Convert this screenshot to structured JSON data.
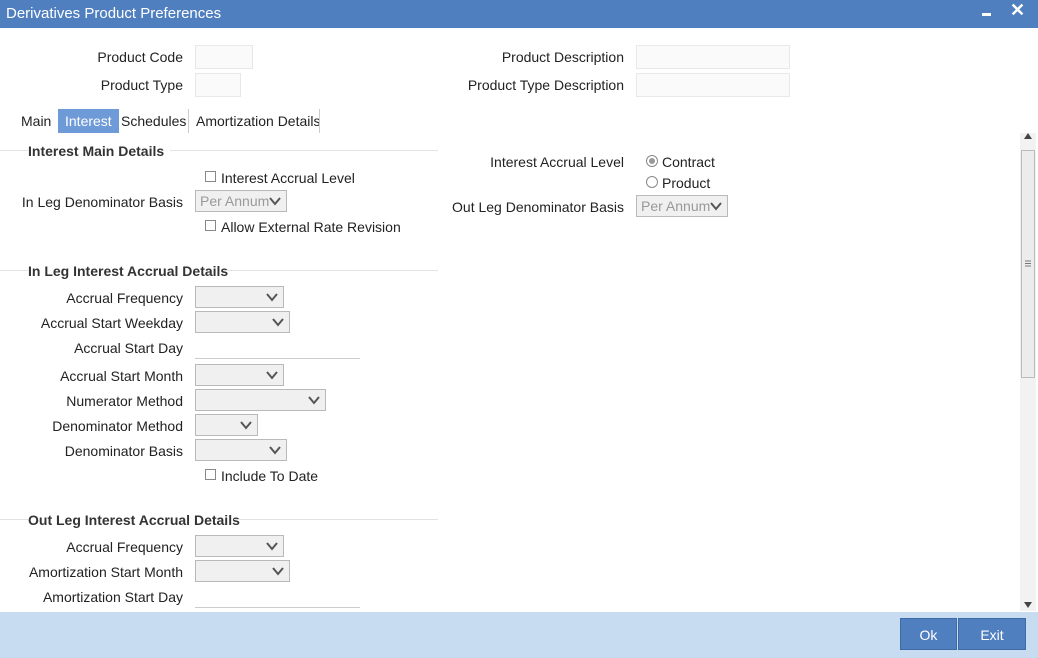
{
  "window": {
    "title": "Derivatives Product Preferences",
    "minimize_glyph": "▬",
    "close_glyph": "✕"
  },
  "header": {
    "product_code_label": "Product Code",
    "product_type_label": "Product Type",
    "product_description_label": "Product Description",
    "product_type_description_label": "Product Type Description"
  },
  "tabs": [
    {
      "label": "Main",
      "active": false
    },
    {
      "label": "Interest",
      "active": true
    },
    {
      "label": "Schedules",
      "active": false
    },
    {
      "label": "Amortization Details",
      "active": false
    }
  ],
  "interest_main": {
    "title": "Interest Main Details",
    "interest_accrual_level_checkbox": "Interest Accrual Level",
    "in_leg_denominator_basis_label": "In Leg Denominator Basis",
    "in_leg_denominator_basis_value": "Per Annum",
    "allow_external_rate_revision": "Allow External Rate Revision",
    "interest_accrual_level_label": "Interest Accrual Level",
    "radio_contract": "Contract",
    "radio_product": "Product",
    "selected_level": "Contract",
    "out_leg_denominator_basis_label": "Out Leg Denominator Basis",
    "out_leg_denominator_basis_value": "Per Annum"
  },
  "in_leg": {
    "title": "In Leg Interest Accrual Details",
    "accrual_frequency": "Accrual Frequency",
    "accrual_start_weekday": "Accrual Start Weekday",
    "accrual_start_day": "Accrual Start Day",
    "accrual_start_month": "Accrual Start Month",
    "numerator_method": "Numerator Method",
    "denominator_method": "Denominator Method",
    "denominator_basis": "Denominator Basis",
    "include_to_date": "Include To Date"
  },
  "out_leg": {
    "title": "Out Leg Interest Accrual Details",
    "accrual_frequency": "Accrual Frequency",
    "amortization_start_month": "Amortization Start Month",
    "amortization_start_day": "Amortization Start Day"
  },
  "footer": {
    "ok_label": "Ok",
    "exit_label": "Exit"
  },
  "colors": {
    "titlebar": "#4f7fbf",
    "active_tab": "#6f9ad8",
    "footer": "#c7dcf1"
  }
}
